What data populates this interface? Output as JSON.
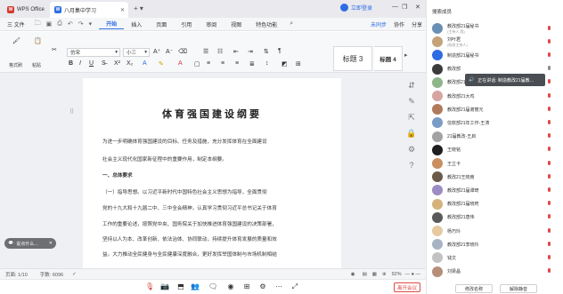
{
  "titlebar": {
    "app_tab": "WPS Office",
    "doc_tab": "八月集中学习",
    "login": "立即登录"
  },
  "menu": {
    "file": "三 文件",
    "items": [
      "开始",
      "插入",
      "页面",
      "引用",
      "审阅",
      "视图",
      "特色功能"
    ],
    "active": "开始",
    "right": [
      "未同步",
      "协作",
      "分享"
    ]
  },
  "ribbon": {
    "format_brush": "格式刷",
    "paste": "粘贴",
    "font": "仿宋",
    "size": "小三",
    "styles": [
      "标题 3",
      "标题 4"
    ]
  },
  "document": {
    "title": "体育强国建设纲要",
    "paragraphs": [
      "为进一步明确体育强国建设的目标、任务及措施，充分发挥体育在全面建设",
      "社会主义现代化国家新征程中的重要作用，制定本纲要。",
      "一、总体要求",
      "（一）指导思想。以习近平新时代中国特色社会主义思想为指导，全面贯彻",
      "党的十九大和十九届二中、三中全会精神，认真学习贯彻习近平总书记关于体育",
      "工作的重要论述，按照党中央、国务院关于加快推进体育强国建设的决策部署，",
      "坚持以人为本、改革创新、依法治体、协同联动，持续提升体育发展的质量和效",
      "益。大力推动全民健身与全民健康深度融合，更好发挥举国体制与市场机制相结"
    ]
  },
  "chat_bubble": "说点什么…",
  "status": {
    "page": "页面: 1/10",
    "words": "字数: 6096",
    "zoom": "92%"
  },
  "meeting": {
    "leave": "离开会议"
  },
  "panel": {
    "header": "搜索成员",
    "speaking": "正在讲话: 制造教改21届教…",
    "participants": [
      {
        "name": "教改部21届秘书",
        "sub": "(主持人,我)",
        "color": "#6a8fb5",
        "mic": "muted"
      },
      {
        "name": "刘叶君",
        "sub": "(联席主持人)",
        "color": "#c4a27a",
        "mic": "muted"
      },
      {
        "name": "制造部21届秘书",
        "sub": "",
        "color": "#2e6ce4",
        "mic": "muted"
      },
      {
        "name": "教改部",
        "sub": "",
        "color": "#3b3b3b",
        "mic": "on"
      },
      {
        "name": "教改部21大鹅",
        "sub": "",
        "color": "#8fb58a",
        "mic": "muted"
      },
      {
        "name": "教改部21大鸡",
        "sub": "",
        "color": "#d6a5a0",
        "mic": "muted"
      },
      {
        "name": "教改部21届谢丽元",
        "sub": "",
        "color": "#b07b5a",
        "mic": "muted"
      },
      {
        "name": "信软部21年工作-王涛",
        "sub": "",
        "color": "#7a9cc6",
        "mic": "muted"
      },
      {
        "name": "21届教改-王启",
        "sub": "",
        "color": "#a3a3a3",
        "mic": "muted"
      },
      {
        "name": "王晓铭",
        "sub": "",
        "color": "#1f1f1f",
        "mic": "muted"
      },
      {
        "name": "王立卡",
        "sub": "",
        "color": "#c98f5e",
        "mic": "muted"
      },
      {
        "name": "教改21王晓南",
        "sub": "",
        "color": "#6b5a4a",
        "mic": "muted"
      },
      {
        "name": "教改部21届谭琦",
        "sub": "",
        "color": "#9b8cc4",
        "mic": "muted"
      },
      {
        "name": "教改部21届晓珂",
        "sub": "",
        "color": "#d4b27a",
        "mic": "muted"
      },
      {
        "name": "教改部21唐伟",
        "sub": "",
        "color": "#5a5a5a",
        "mic": "muted"
      },
      {
        "name": "杨巧玲",
        "sub": "",
        "color": "#e6c9a0",
        "mic": "muted"
      },
      {
        "name": "教改部21李晓玲",
        "sub": "",
        "color": "#a7b3c2",
        "mic": "muted"
      },
      {
        "name": "钱文",
        "sub": "",
        "color": "#c2c2c2",
        "mic": "muted"
      },
      {
        "name": "刘梁晶",
        "sub": "",
        "color": "#b58f7a",
        "mic": "muted"
      }
    ],
    "btn_edit": "修改名称",
    "btn_mute_all": "解除静音"
  }
}
